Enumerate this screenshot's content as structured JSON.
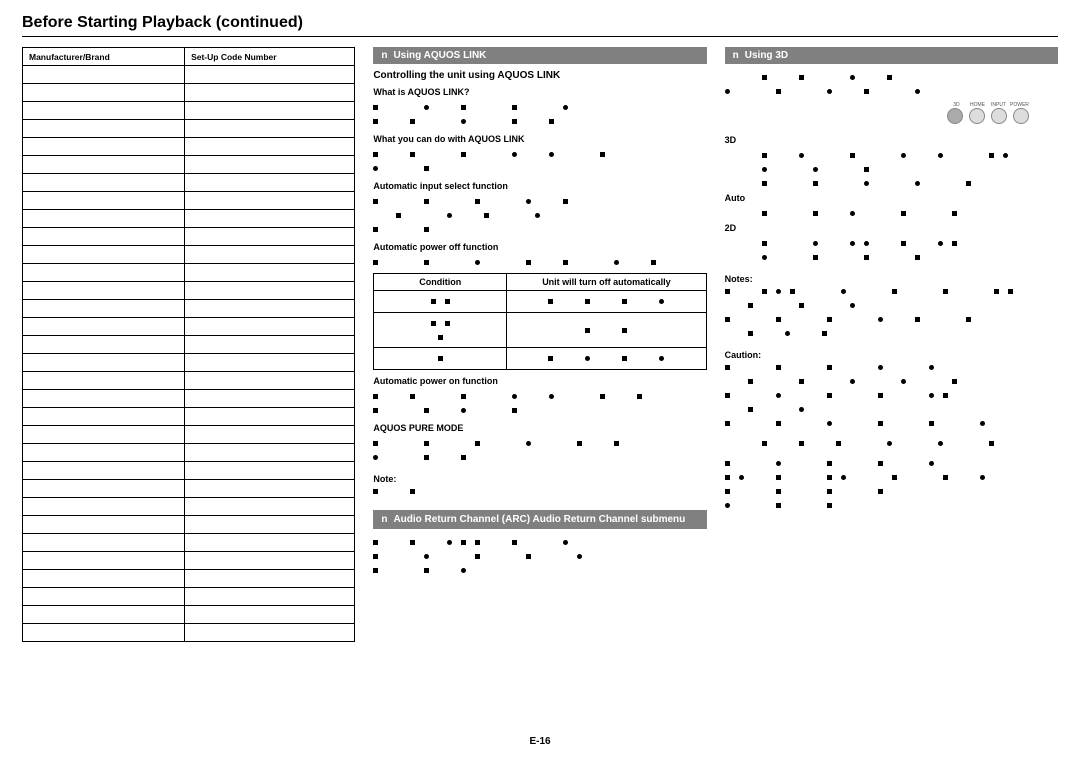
{
  "page": {
    "title": "Before Starting Playback (continued)",
    "footer": "E-16"
  },
  "left_table": {
    "headers": [
      "Manufacturer/Brand",
      "Set-Up Code Number"
    ],
    "row_count": 32
  },
  "mid": {
    "bar1": "Using AQUOS LINK",
    "subtitle": "Controlling the unit using AQUOS LINK",
    "h_what": "What is AQUOS LINK?",
    "h_cando": "What you can do with AQUOS LINK",
    "h_autoinput": "Automatic input select function",
    "h_autooff": "Automatic power off function",
    "cond_headers": [
      "Condition",
      "Unit will turn off automatically"
    ],
    "h_autoon": "Automatic power on function",
    "h_puremode": "AQUOS PURE MODE",
    "note_label": "Note:",
    "bar2": "Audio Return Channel (ARC) Audio Return Channel submenu"
  },
  "right": {
    "bar": "Using 3D",
    "remote_labels": [
      "3D",
      "HOME",
      "INPUT",
      "POWER"
    ],
    "mode_3d": "3D",
    "mode_auto": "Auto",
    "mode_2d": "2D",
    "notes_label": "Notes:",
    "caution_label": "Caution:"
  }
}
